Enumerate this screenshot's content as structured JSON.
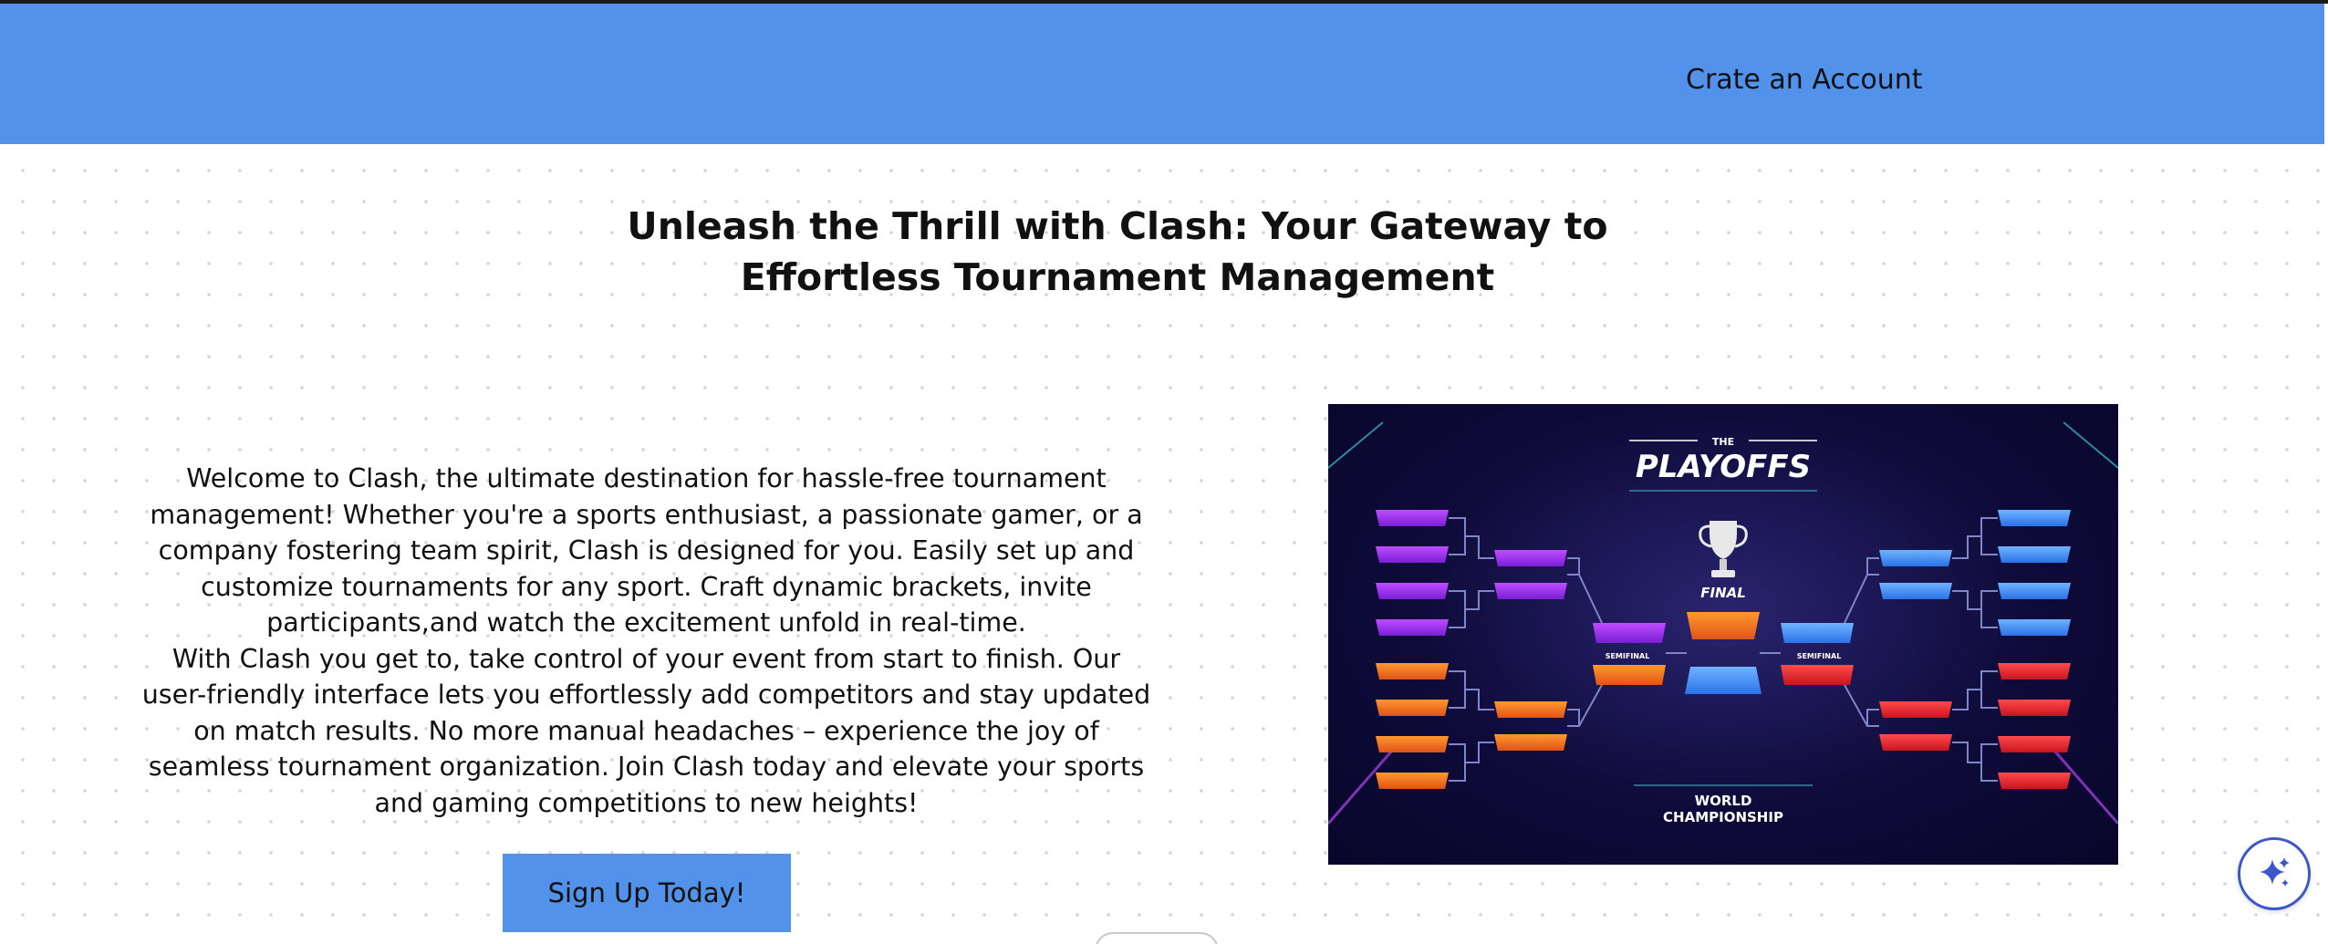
{
  "navbar": {
    "account_link": "Crate an Account",
    "color": "#5392ea"
  },
  "hero": {
    "title_line1": "Unleash the Thrill with Clash: Your Gateway to",
    "title_line2": "Effortless Tournament Management",
    "paragraph1": "Welcome to Clash, the ultimate destination for hassle-free tournament management! Whether you're a sports enthusiast, a passionate gamer, or a company fostering team spirit, Clash is designed for you. Easily set up and customize tournaments for any sport. Craft dynamic brackets, invite participants,and watch the excitement unfold in real-time.",
    "paragraph2": "With Clash you get to, take control of your event from start to finish. Our user-friendly interface lets you effortlessly add competitors and stay updated on match results. No more manual headaches – experience the joy of seamless tournament organization. Join Clash today and elevate your sports and gaming competitions to new heights!",
    "cta_label": "Sign Up Today!"
  },
  "image": {
    "header_small": "THE",
    "header_big": "PLAYOFFS",
    "final_label": "FINAL",
    "semifinal_left": "SEMIFINAL",
    "semifinal_right": "SEMIFINAL",
    "footer_line1": "WORLD",
    "footer_line2": "CHAMPIONSHIP",
    "icon": "trophy-icon"
  },
  "floating_button": {
    "icon": "sparkle-icon",
    "color": "#3b57c9"
  }
}
